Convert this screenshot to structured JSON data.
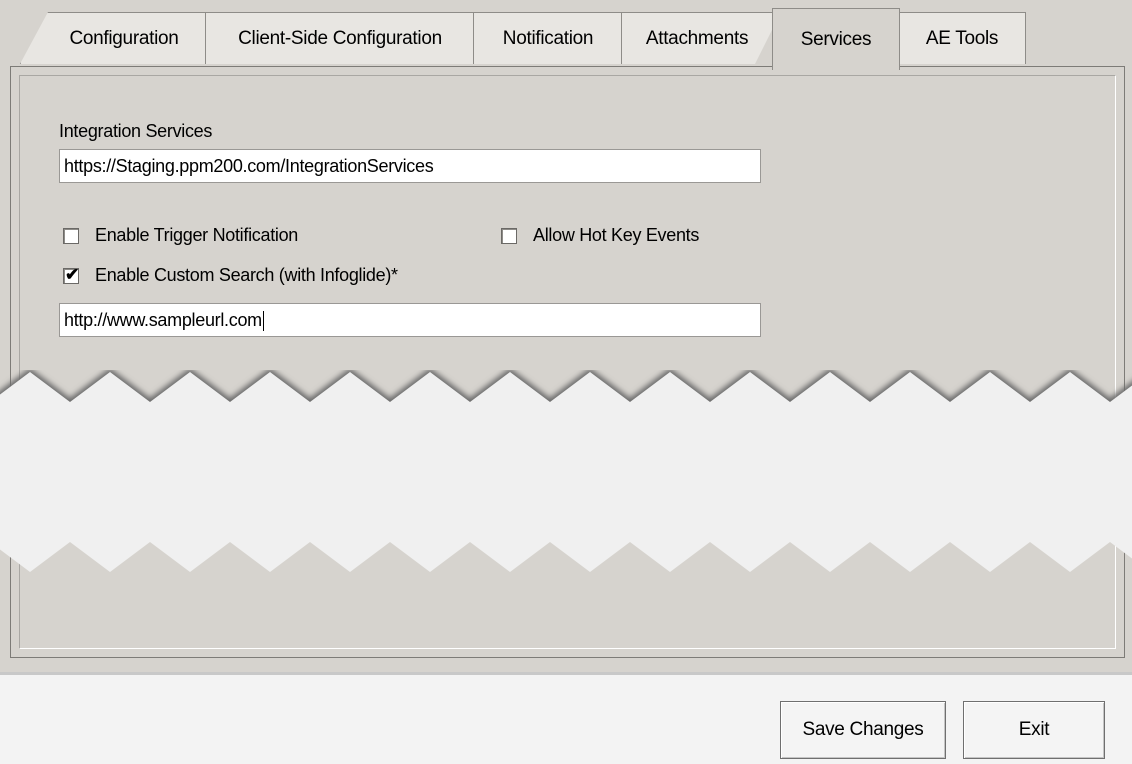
{
  "tabs": [
    {
      "label": "Configuration",
      "active": false
    },
    {
      "label": "Client-Side Configuration",
      "active": false
    },
    {
      "label": "Notification",
      "active": false
    },
    {
      "label": "Attachments",
      "active": false
    },
    {
      "label": "Services",
      "active": true
    },
    {
      "label": "AE Tools",
      "active": false
    }
  ],
  "services": {
    "integration_label": "Integration Services",
    "integration_value": "https://Staging.ppm200.com/IntegrationServices",
    "enable_trigger": {
      "label": "Enable Trigger Notification",
      "checked": false
    },
    "allow_hotkey": {
      "label": "Allow Hot Key Events",
      "checked": false
    },
    "enable_custom_search": {
      "label": "Enable Custom Search (with Infoglide)*",
      "checked": true
    },
    "custom_search_url": "http://www.sampleurl.com"
  },
  "footer": {
    "save_label": "Save Changes",
    "exit_label": "Exit"
  },
  "check_glyph": "✔"
}
